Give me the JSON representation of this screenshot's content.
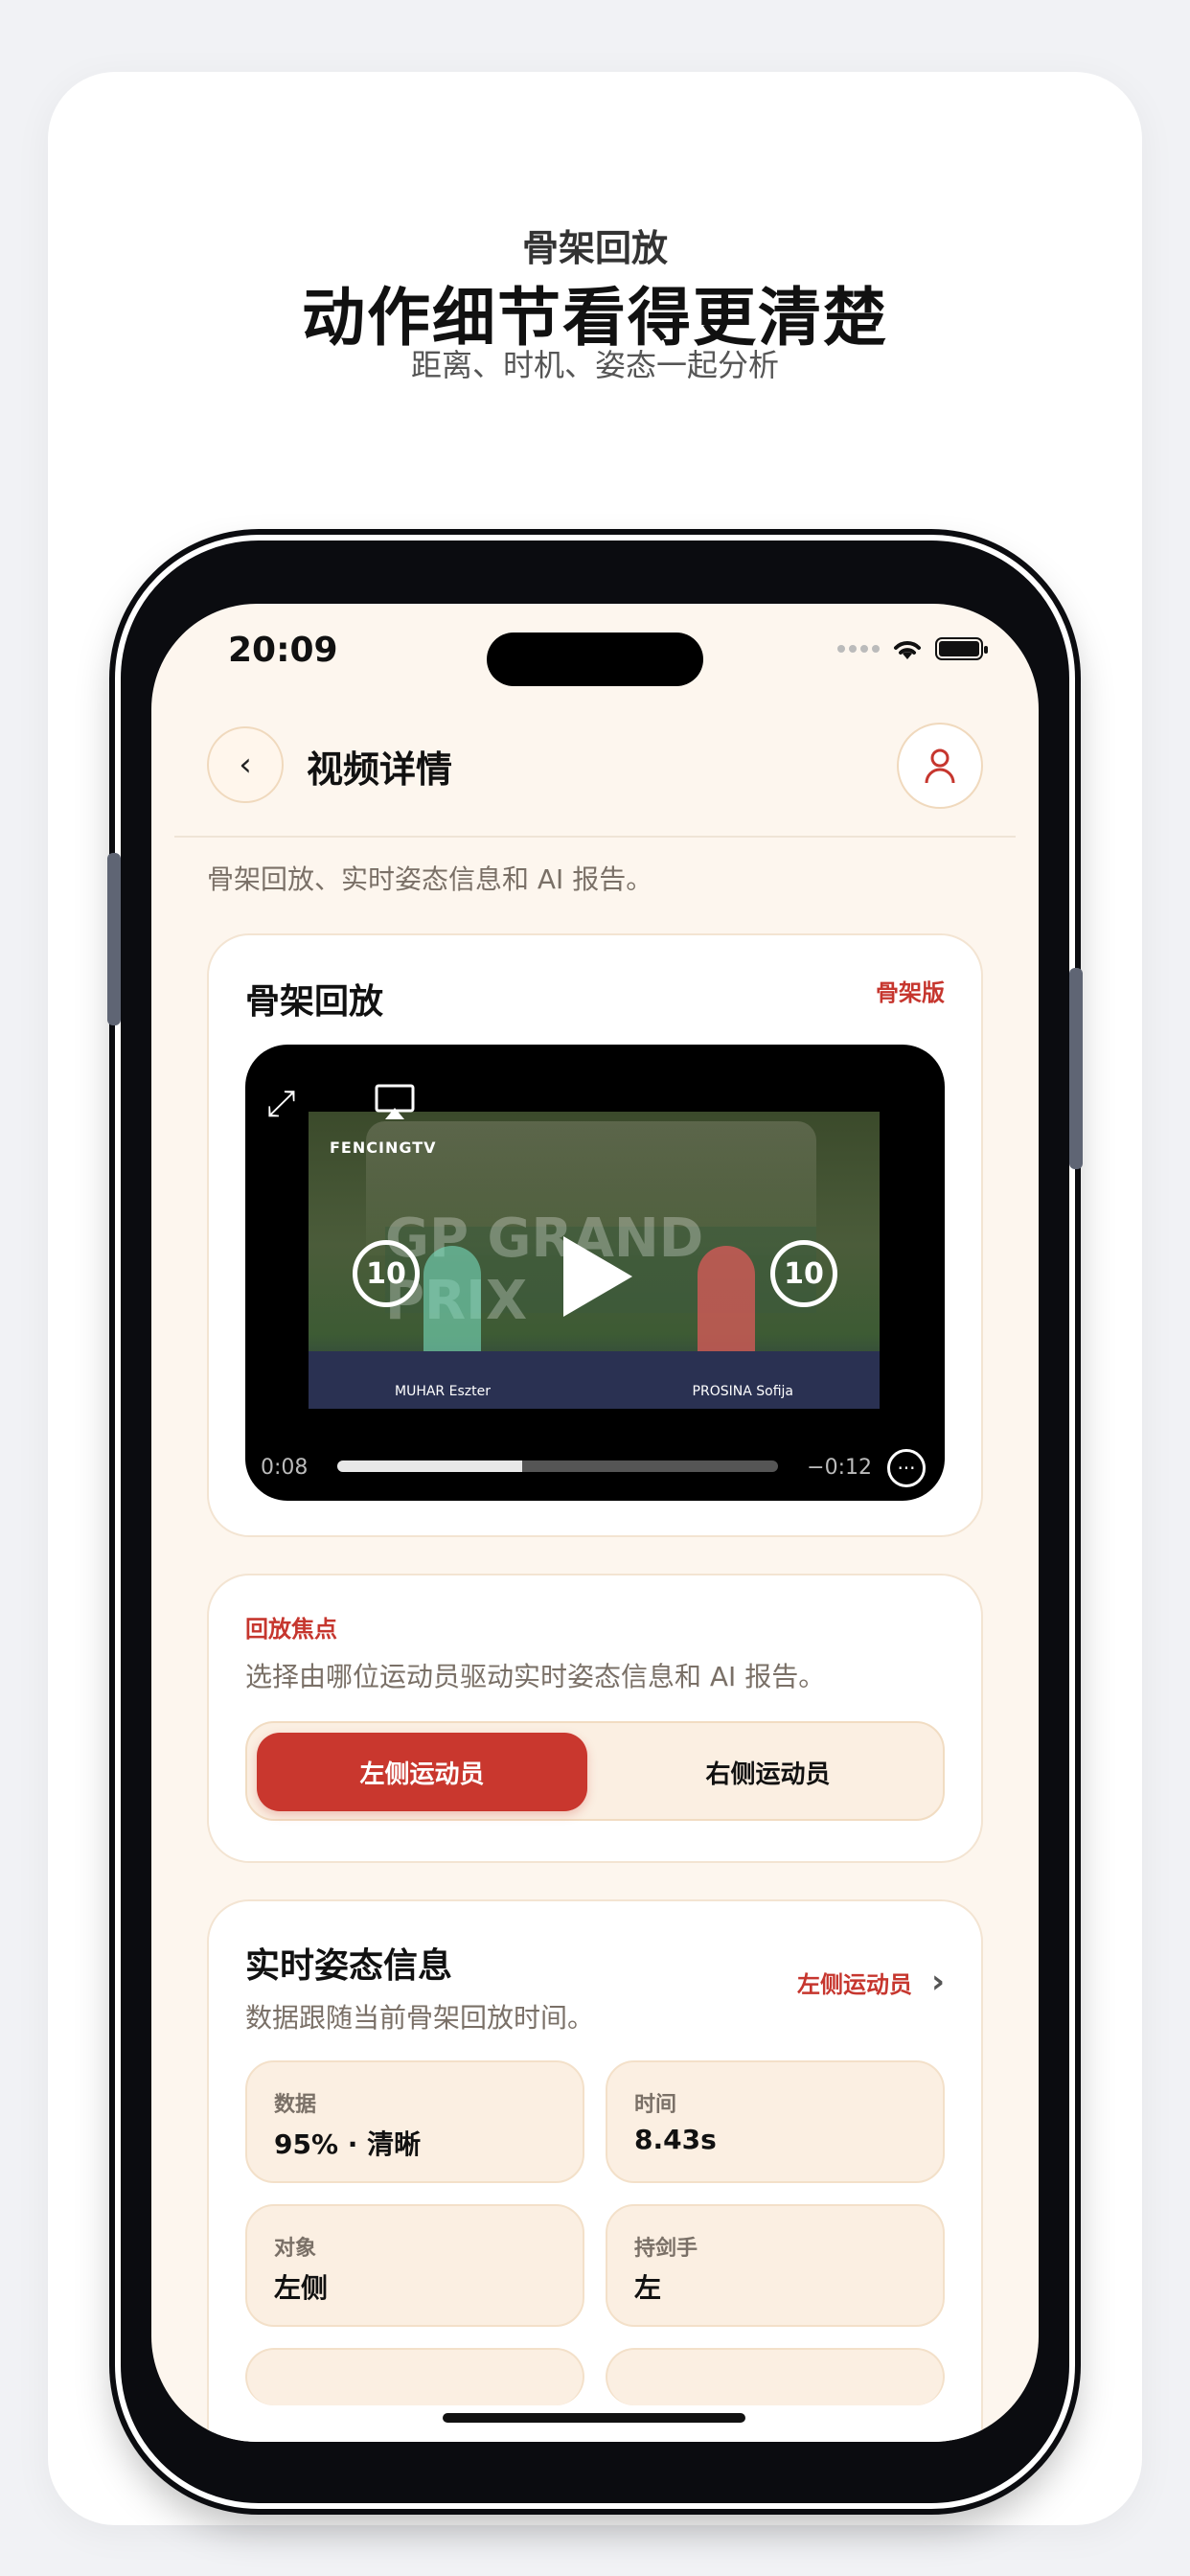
{
  "hero": {
    "subtitle": "骨架回放",
    "title": "动作细节看得更清楚",
    "description": "距离、时机、姿态一起分析"
  },
  "status_bar": {
    "time": "20:09"
  },
  "nav": {
    "title": "视频详情"
  },
  "intro": "骨架回放、实时姿态信息和 AI 报告。",
  "playback_card": {
    "title": "骨架回放",
    "badge": "骨架版",
    "video": {
      "brand": "FENCINGTV",
      "board_text": "GP GRAND PRIX",
      "left_name": "MUHAR Eszter",
      "right_name": "PROSINA Sofija",
      "skip_back_label": "10",
      "skip_forward_label": "10",
      "current_time": "0:08",
      "remaining_time": "−0:12",
      "progress": 0.42
    }
  },
  "focus_card": {
    "label": "回放焦点",
    "description": "选择由哪位运动员驱动实时姿态信息和 AI 报告。",
    "options": [
      "左侧运动员",
      "右侧运动员"
    ],
    "selected": "左侧运动员"
  },
  "stats_card": {
    "title": "实时姿态信息",
    "description": "数据跟随当前骨架回放时间。",
    "athlete_link": "左侧运动员",
    "tiles": [
      {
        "label": "数据",
        "value": "95% · 清晰"
      },
      {
        "label": "时间",
        "value": "8.43s"
      },
      {
        "label": "对象",
        "value": "左侧"
      },
      {
        "label": "持剑手",
        "value": "左"
      }
    ]
  },
  "colors": {
    "accent": "#c9372e",
    "background": "#fdf6ee",
    "tile": "#fbefe2"
  }
}
